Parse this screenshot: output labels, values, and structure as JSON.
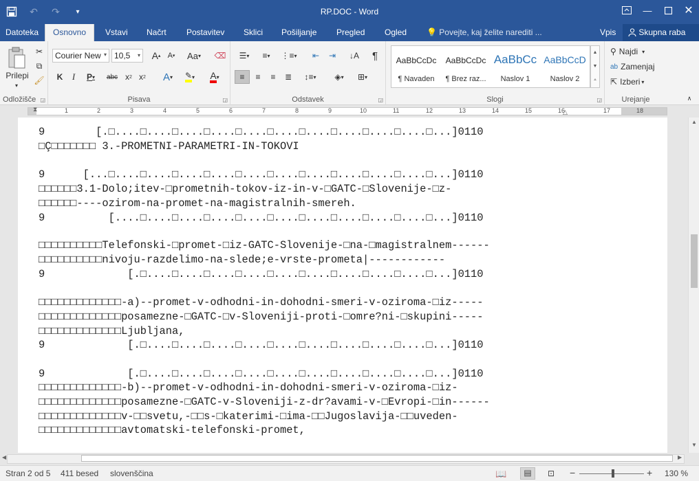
{
  "window": {
    "title": "RP.DOC - Word"
  },
  "qat": {
    "save_icon": "save-icon",
    "undo_icon": "undo-icon",
    "redo_icon": "redo-icon",
    "customize_icon": "customize-qat-icon"
  },
  "tabs": [
    "Datoteka",
    "Osnovno",
    "Vstavi",
    "Načrt",
    "Postavitev",
    "Sklici",
    "Pošiljanje",
    "Pregled",
    "Ogled"
  ],
  "tell_me": "Povejte, kaj želite narediti ...",
  "sign_in": "Vpis",
  "share": "Skupna raba",
  "ribbon": {
    "clipboard": {
      "label": "Odložišče",
      "paste": "Prilepi"
    },
    "font": {
      "label": "Pisava",
      "name": "Courier New",
      "size": "10,5"
    },
    "paragraph": {
      "label": "Odstavek"
    },
    "styles": {
      "label": "Slogi",
      "items": [
        {
          "sample": "AaBbCcDc",
          "name": "¶ Navaden"
        },
        {
          "sample": "AaBbCcDc",
          "name": "¶ Brez raz..."
        },
        {
          "sample": "AaBbCc",
          "name": "Naslov 1"
        },
        {
          "sample": "AaBbCcD",
          "name": "Naslov 2"
        }
      ]
    },
    "editing": {
      "label": "Urejanje",
      "find": "Najdi",
      "replace": "Zamenjaj",
      "select": "Izberi"
    }
  },
  "ruler_numbers": [
    "1",
    "2",
    "3",
    "4",
    "5",
    "6",
    "7",
    "8",
    "9",
    "10",
    "11",
    "12",
    "13",
    "14",
    "15",
    "16",
    "17",
    "18"
  ],
  "document_lines": [
    "9        [.□....□....□....□....□....□....□....□....□....□....□...]0110",
    "□Ç□□□□□□□ 3.-PROMETNI-PARAMETRI-IN-TOKOVI",
    "9      [...□....□....□....□....□....□....□....□....□....□....□...]0110",
    "□□□□□□3.1-Dolo;itev-□prometnih-tokov-iz-in-v-□GATC-□Slovenije-□z-",
    "□□□□□□----ozirom-na-promet-na-magistralnih-smereh.",
    "9          [....□....□....□....□....□....□....□....□....□....□...]0110",
    "□□□□□□□□□□Telefonski-□promet-□iz-GATC-Slovenije-□na-□magistralnem------",
    "□□□□□□□□□□nivoju-razdelimo-na-slede;e-vrste-prometa|------------",
    "9             [.□....□....□....□....□....□....□....□....□....□...]0110",
    "□□□□□□□□□□□□□-a)--promet-v-odhodni-in-dohodni-smeri-v-oziroma-□iz-----",
    "□□□□□□□□□□□□□posamezne-□GATC-□v-Sloveniji-proti-□omre?ni-□skupini-----",
    "□□□□□□□□□□□□□Ljubljana,",
    "9             [.□....□....□....□....□....□....□....□....□....□...]0110",
    "9             [.□....□....□....□....□....□....□....□....□....□...]0110",
    "□□□□□□□□□□□□□-b)--promet-v-odhodni-in-dohodni-smeri-v-oziroma-□iz-",
    "□□□□□□□□□□□□□posamezne-□GATC-v-Sloveniji-z-dr?avami-v-□Evropi-□in------",
    "□□□□□□□□□□□□□v-□□svetu,-□□s-□katerimi-□ima-□□Jugoslavija-□□uveden-",
    "□□□□□□□□□□□□□avtomatski-telefonski-promet,"
  ],
  "status": {
    "page": "Stran 2 od 5",
    "words": "411 besed",
    "language": "slovenščina",
    "zoom": "130 %"
  }
}
